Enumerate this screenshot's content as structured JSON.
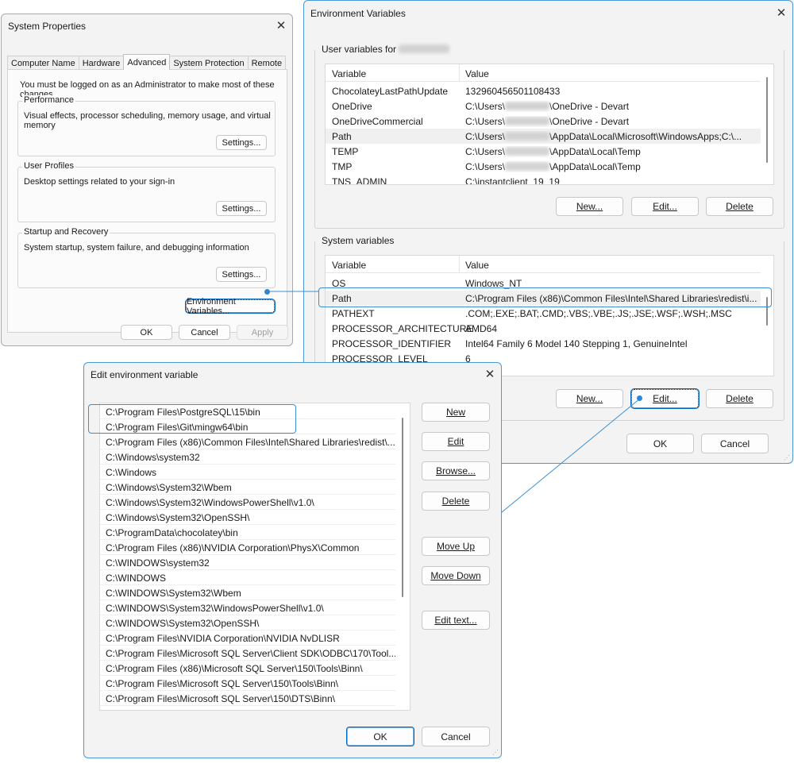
{
  "system_properties": {
    "title": "System Properties",
    "tabs": [
      "Computer Name",
      "Hardware",
      "Advanced",
      "System Protection",
      "Remote"
    ],
    "admin_note": "You must be logged on as an Administrator to make most of these changes.",
    "performance": {
      "title": "Performance",
      "desc": "Visual effects, processor scheduling, memory usage, and virtual memory",
      "settings": "Settings..."
    },
    "user_profiles": {
      "title": "User Profiles",
      "desc": "Desktop settings related to your sign-in",
      "settings": "Settings..."
    },
    "startup": {
      "title": "Startup and Recovery",
      "desc": "System startup, system failure, and debugging information",
      "settings": "Settings..."
    },
    "env_button": "Environment Variables...",
    "ok": "OK",
    "cancel": "Cancel",
    "apply": "Apply"
  },
  "env_vars": {
    "title": "Environment Variables",
    "user_group_label": "User variables for",
    "columns": [
      "Variable",
      "Value"
    ],
    "user_rows": [
      {
        "name": "ChocolateyLastPathUpdate",
        "pre": "132960456501108433",
        "post": ""
      },
      {
        "name": "OneDrive",
        "pre": "C:\\Users\\",
        "post": "\\OneDrive - Devart"
      },
      {
        "name": "OneDriveCommercial",
        "pre": "C:\\Users\\",
        "post": "\\OneDrive - Devart"
      },
      {
        "name": "Path",
        "pre": "C:\\Users\\",
        "post": "\\AppData\\Local\\Microsoft\\WindowsApps;C:\\..."
      },
      {
        "name": "TEMP",
        "pre": "C:\\Users\\",
        "post": "\\AppData\\Local\\Temp"
      },
      {
        "name": "TMP",
        "pre": "C:\\Users\\",
        "post": "\\AppData\\Local\\Temp"
      },
      {
        "name": "TNS_ADMIN",
        "pre": "C:\\instantclient_19_19",
        "post": ""
      }
    ],
    "system_group_label": "System variables",
    "system_rows": [
      {
        "name": "OS",
        "value": "Windows_NT"
      },
      {
        "name": "Path",
        "value": "C:\\Program Files (x86)\\Common Files\\Intel\\Shared Libraries\\redist\\i..."
      },
      {
        "name": "PATHEXT",
        "value": ".COM;.EXE;.BAT;.CMD;.VBS;.VBE;.JS;.JSE;.WSF;.WSH;.MSC"
      },
      {
        "name": "PROCESSOR_ARCHITECTURE",
        "value": "AMD64"
      },
      {
        "name": "PROCESSOR_IDENTIFIER",
        "value": "Intel64 Family 6 Model 140 Stepping 1, GenuineIntel"
      },
      {
        "name": "PROCESSOR_LEVEL",
        "value": "6"
      }
    ],
    "new": "New...",
    "edit": "Edit...",
    "delete": "Delete",
    "ok": "OK",
    "cancel": "Cancel"
  },
  "edit_env": {
    "title": "Edit environment variable",
    "paths": [
      "C:\\Program Files\\PostgreSQL\\15\\bin",
      "C:\\Program Files\\Git\\mingw64\\bin",
      "C:\\Program Files (x86)\\Common Files\\Intel\\Shared Libraries\\redist\\...",
      "C:\\Windows\\system32",
      "C:\\Windows",
      "C:\\Windows\\System32\\Wbem",
      "C:\\Windows\\System32\\WindowsPowerShell\\v1.0\\",
      "C:\\Windows\\System32\\OpenSSH\\",
      "C:\\ProgramData\\chocolatey\\bin",
      "C:\\Program Files (x86)\\NVIDIA Corporation\\PhysX\\Common",
      "C:\\WINDOWS\\system32",
      "C:\\WINDOWS",
      "C:\\WINDOWS\\System32\\Wbem",
      "C:\\WINDOWS\\System32\\WindowsPowerShell\\v1.0\\",
      "C:\\WINDOWS\\System32\\OpenSSH\\",
      "C:\\Program Files\\NVIDIA Corporation\\NVIDIA NvDLISR",
      "C:\\Program Files\\Microsoft SQL Server\\Client SDK\\ODBC\\170\\Tool...",
      "C:\\Program Files (x86)\\Microsoft SQL Server\\150\\Tools\\Binn\\",
      "C:\\Program Files\\Microsoft SQL Server\\150\\Tools\\Binn\\",
      "C:\\Program Files\\Microsoft SQL Server\\150\\DTS\\Binn\\"
    ],
    "buttons": {
      "new": "New",
      "edit": "Edit",
      "browse": "Browse...",
      "delete": "Delete",
      "move_up": "Move Up",
      "move_down": "Move Down",
      "edit_text": "Edit text...",
      "ok": "OK",
      "cancel": "Cancel"
    }
  },
  "colors": {
    "accent": "#0067c0",
    "callout": "#3a8fd4",
    "dialog_bg": "#f3f3f3"
  }
}
